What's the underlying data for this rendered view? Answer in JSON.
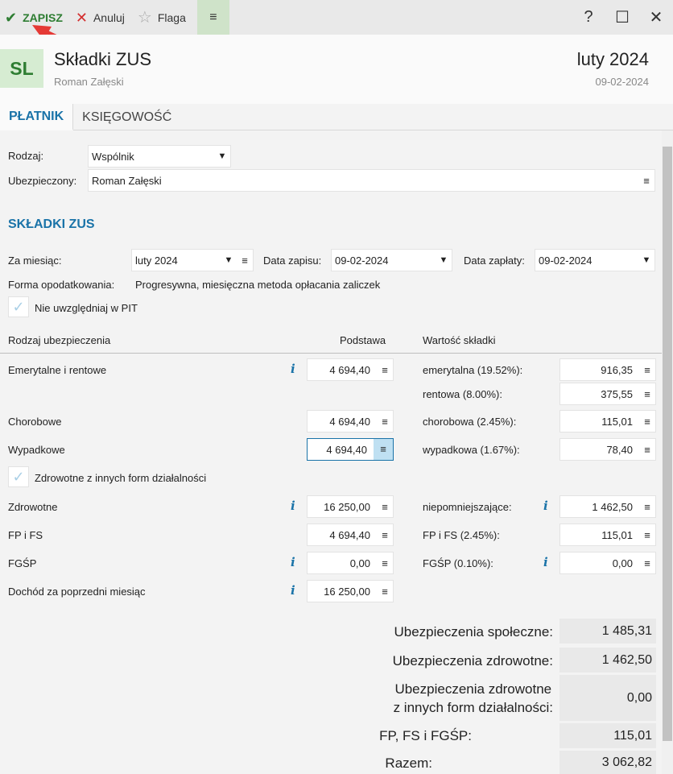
{
  "toolbar": {
    "save_label": "ZAPISZ",
    "cancel_label": "Anuluj",
    "flag_label": "Flaga",
    "menu_icon": "hamburger-icon",
    "help_icon": "?",
    "maximize_icon": "☐",
    "close_icon": "✕"
  },
  "header": {
    "avatar": "SL",
    "title": "Składki ZUS",
    "subtitle": "Roman Załęski",
    "period": "luty 2024",
    "date": "09-02-2024"
  },
  "tabs": [
    {
      "label": "PŁATNIK",
      "active": true
    },
    {
      "label": "KSIĘGOWOŚĆ",
      "active": false
    }
  ],
  "payer": {
    "type_label": "Rodzaj:",
    "type_value": "Wspólnik",
    "insured_label": "Ubezpieczony:",
    "insured_value": "Roman Załęski"
  },
  "zus": {
    "section_title": "SKŁADKI ZUS",
    "month_label": "Za miesiąc:",
    "month_value": "luty 2024",
    "record_date_label": "Data zapisu:",
    "record_date_value": "09-02-2024",
    "payment_date_label": "Data zapłaty:",
    "payment_date_value": "09-02-2024",
    "tax_form_label": "Forma opodatkowania:",
    "tax_form_value": "Progresywna, miesięczna metoda opłacania zaliczek",
    "exclude_pit_label": "Nie uwzględniaj w PIT",
    "col_type": "Rodzaj ubezpieczenia",
    "col_base": "Podstawa",
    "col_value": "Wartość składki",
    "pension_label": "Emerytalne i rentowe",
    "pension_base": "4 694,40",
    "emerytalna_label": "emerytalna (19.52%):",
    "emerytalna_value": "916,35",
    "rentowa_label": "rentowa (8.00%):",
    "rentowa_value": "375,55",
    "sickness_label": "Chorobowe",
    "sickness_base": "4 694,40",
    "chorobowa_label": "chorobowa (2.45%):",
    "chorobowa_value": "115,01",
    "accident_label": "Wypadkowe",
    "accident_base": "4 694,40",
    "wypadkowa_label": "wypadkowa (1.67%):",
    "wypadkowa_value": "78,40",
    "health_other_label": "Zdrowotne z innych form działalności",
    "health_label": "Zdrowotne",
    "health_base": "16 250,00",
    "niepomniejszajace_label": "niepomniejszające:",
    "niepomniejszajace_value": "1 462,50",
    "fpfs_label": "FP i FS",
    "fpfs_base": "4 694,40",
    "fpfs_rate_label": "FP i FS (2.45%):",
    "fpfs_value": "115,01",
    "fgsp_label": "FGŚP",
    "fgsp_base": "0,00",
    "fgsp_rate_label": "FGŚP (0.10%):",
    "fgsp_value": "0,00",
    "income_label": "Dochód za poprzedni miesiąc",
    "income_value": "16 250,00",
    "info_glyph": "i"
  },
  "summary": {
    "social_label": "Ubezpieczenia społeczne:",
    "social_value": "1 485,31",
    "health_label": "Ubezpieczenia zdrowotne:",
    "health_value": "1 462,50",
    "health_other_label_1": "Ubezpieczenia zdrowotne",
    "health_other_label_2": "z innych form działalności:",
    "health_other_value": "0,00",
    "fp_fs_fgsp_label": "FP, FS i FGŚP:",
    "fp_fs_fgsp_value": "115,01",
    "total_label": "Razem:",
    "total_value": "3 062,82"
  },
  "colors": {
    "accent_blue": "#1a73a8",
    "save_green": "#2e7d32",
    "cancel_red": "#d32f2f",
    "annotation_arrow": "#e53935"
  }
}
